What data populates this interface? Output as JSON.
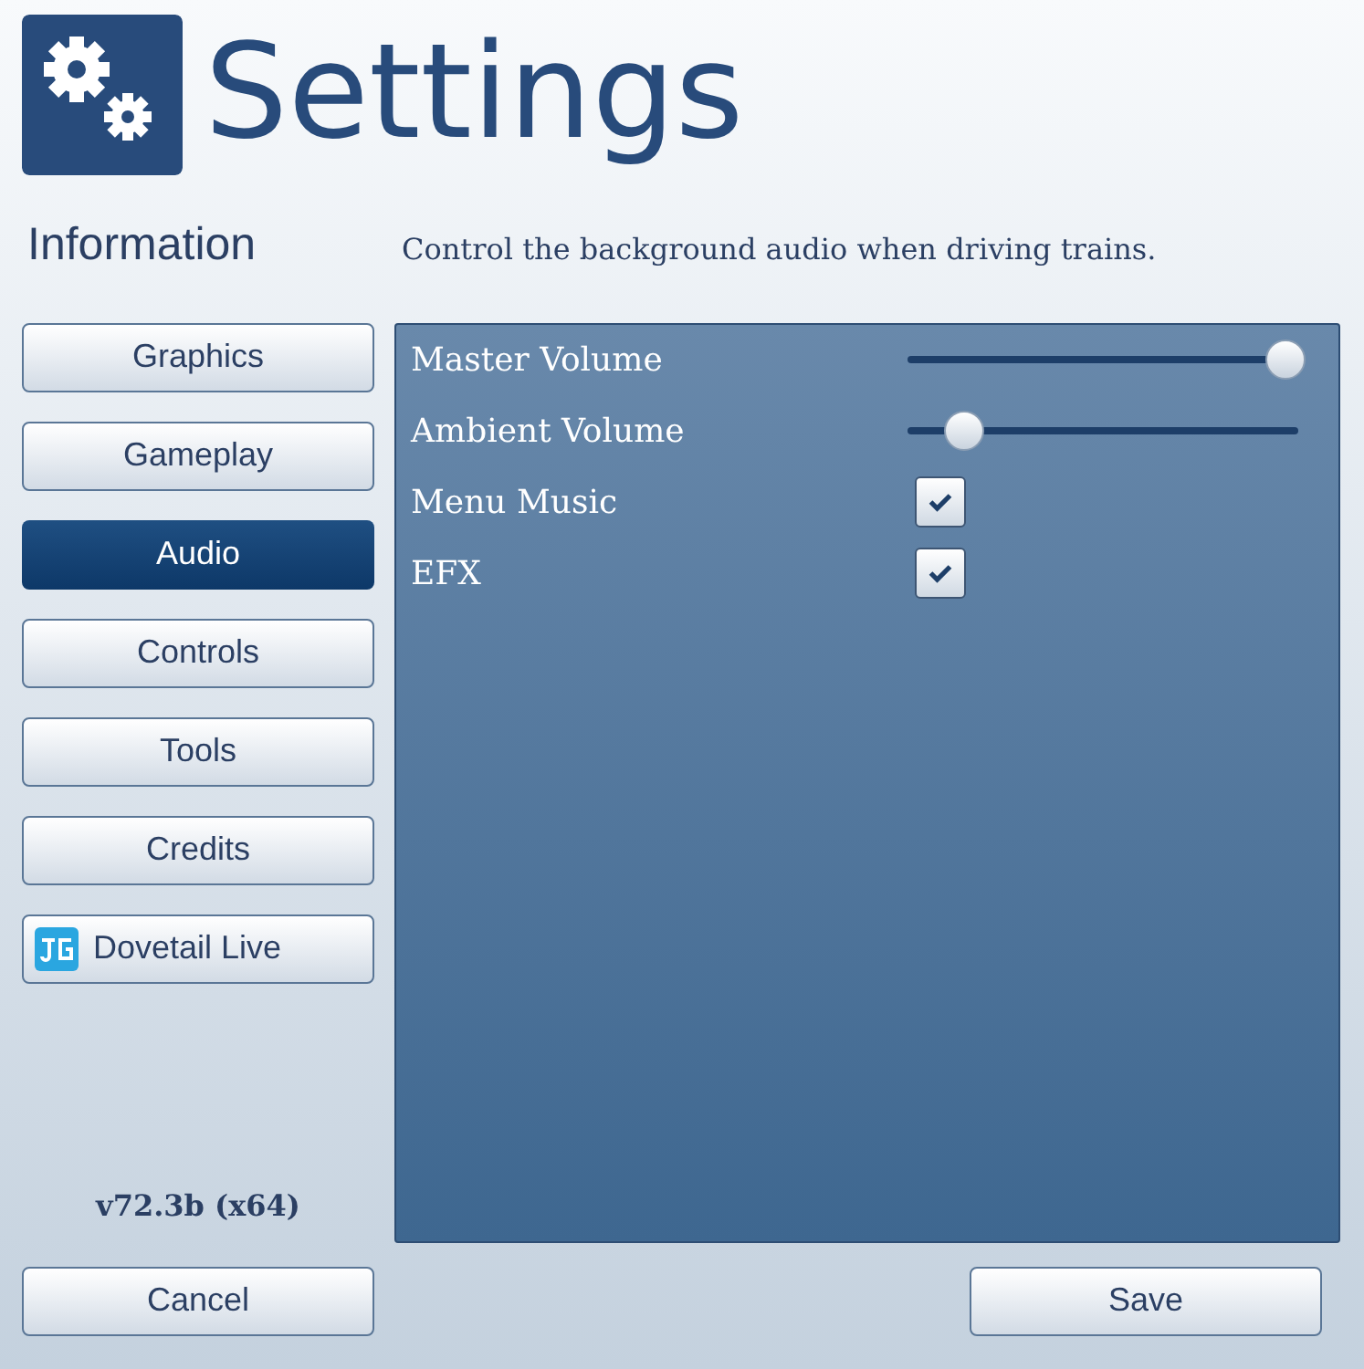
{
  "header": {
    "title": "Settings"
  },
  "info": {
    "heading": "Information",
    "description": "Control the background audio when driving trains."
  },
  "sidebar": {
    "items": [
      {
        "label": "Graphics",
        "selected": false
      },
      {
        "label": "Gameplay",
        "selected": false
      },
      {
        "label": "Audio",
        "selected": true
      },
      {
        "label": "Controls",
        "selected": false
      },
      {
        "label": "Tools",
        "selected": false
      },
      {
        "label": "Credits",
        "selected": false
      },
      {
        "label": "Dovetail Live",
        "selected": false,
        "kind": "logo"
      }
    ],
    "version": "v72.3b (x64)"
  },
  "settings": [
    {
      "kind": "slider",
      "label": "Master Volume",
      "level": 0.98
    },
    {
      "kind": "slider",
      "label": "Ambient Volume",
      "level": 0.1
    },
    {
      "kind": "checkbox",
      "label": "Menu Music",
      "checked": true
    },
    {
      "kind": "checkbox",
      "label": "EFX",
      "checked": true
    }
  ],
  "buttons": [
    "Cancel",
    "Save"
  ]
}
